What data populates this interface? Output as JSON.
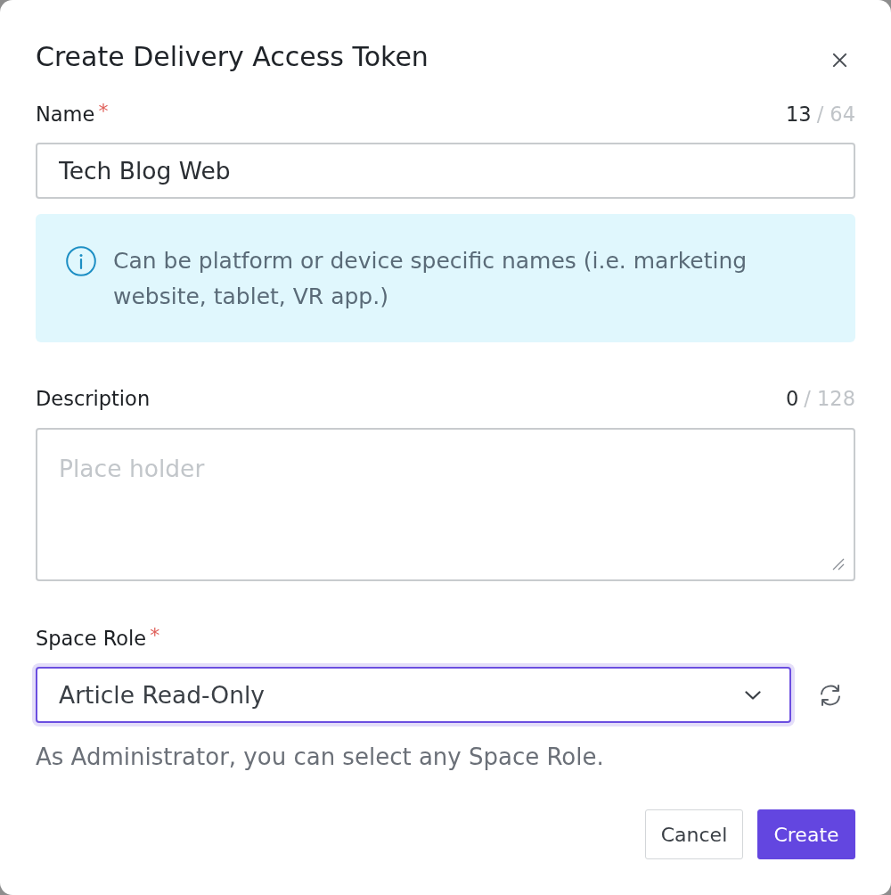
{
  "dialog": {
    "title": "Create Delivery Access Token"
  },
  "fields": [
    {
      "kind": "text",
      "label": "Name",
      "required_mark": "*",
      "counter": {
        "current": "13",
        "limit": "/ 64"
      },
      "value": "Tech Blog Web",
      "focused": false,
      "note": "Can be platform or device specific names (i.e. marketing website, tablet, VR app.)"
    },
    {
      "kind": "textarea",
      "label": "Description",
      "counter": {
        "current": "0",
        "limit": "/ 128"
      },
      "placeholder": "Place holder",
      "focused": false
    },
    {
      "kind": "select",
      "label": "Space Role",
      "required_mark": "*",
      "value": "Article Read-Only",
      "focused": true,
      "helper": "As Administrator, you can select any Space Role."
    }
  ],
  "buttons": [
    {
      "label": "Cancel",
      "kind": "secondary"
    },
    {
      "label": "Create",
      "kind": "primary"
    }
  ]
}
